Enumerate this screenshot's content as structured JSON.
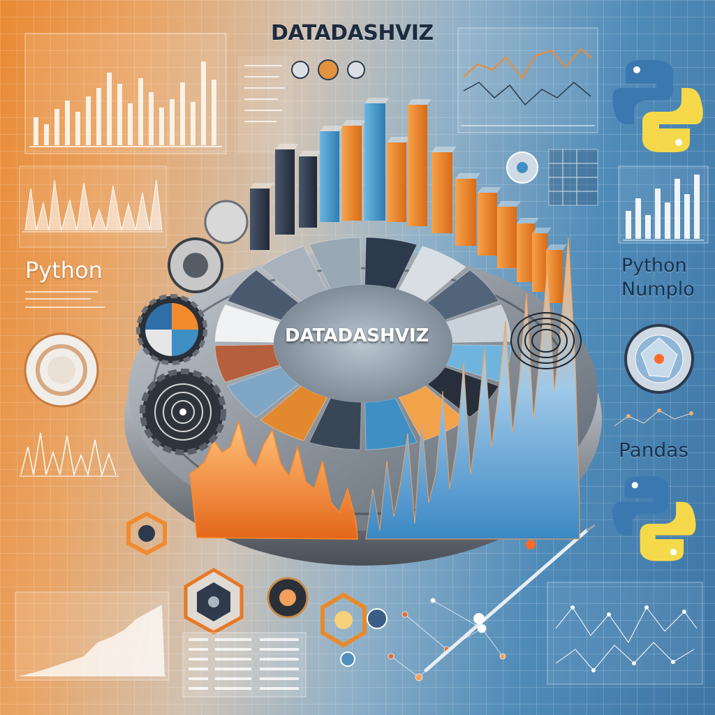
{
  "image": {
    "title_top": "DATADASHVIZ",
    "title_center": "DATADASHVIZ",
    "label_left": "Python",
    "label_right": "Python Numplo",
    "label_pandas": "Pandas"
  },
  "icons": {
    "logo": "python-logo-icon",
    "gear": "gear-icon",
    "hexagon": "hexagon-node-icon"
  },
  "colors": {
    "orange": "#f28a2e",
    "blue": "#3f8fc4",
    "dark": "#2c3a4c",
    "python_blue": "#3c78b0",
    "python_yellow": "#f6d94b"
  }
}
